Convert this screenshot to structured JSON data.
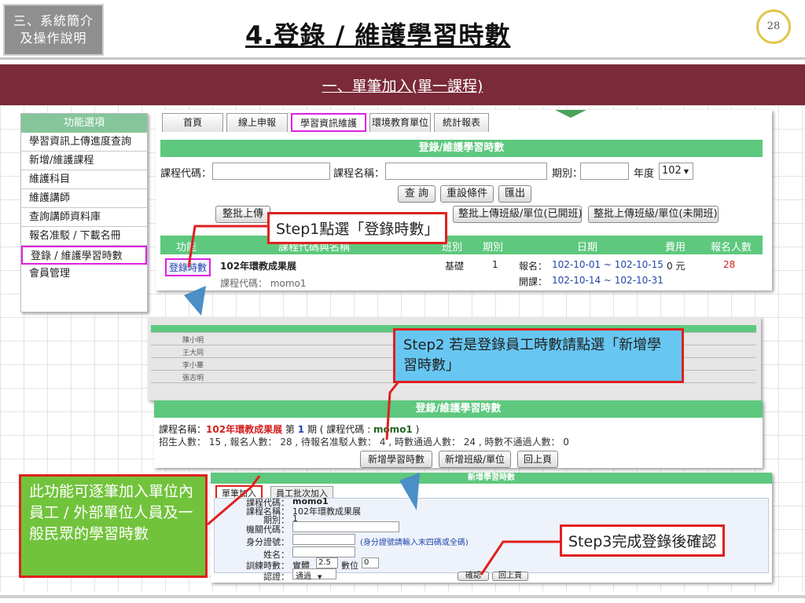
{
  "slide": {
    "chapter_line1": "三、系統簡介",
    "chapter_line2": "及操作說明",
    "title": "4.登錄 / 維護學習時數",
    "page_number": "28",
    "section": "一、單筆加入(單一課程)"
  },
  "sidebar": {
    "header": "功能選項",
    "items": [
      "學習資訊上傳進度查詢",
      "新增/維護課程",
      "維護科目",
      "維護講師",
      "查詢講師資料庫",
      "報名准駁 / 下載名冊",
      "登錄 / 維護學習時數",
      "會員管理"
    ]
  },
  "tabs": [
    "首頁",
    "線上申報",
    "學習資訊維護",
    "環境教育單位",
    "統計報表"
  ],
  "search": {
    "heading": "登錄/維護學習時數",
    "code_label": "課程代碼：",
    "name_label": "課程名稱：",
    "period_label": "期別：",
    "year_label": "年度",
    "year_value": "102",
    "query_button": "查 詢",
    "reset_button": "重設條件",
    "export_button": "匯出",
    "batch_open_button": "整批上傳班級/單位(已開班)",
    "batch_unopen_button": "整批上傳班級/單位(未開班)",
    "batch_left_button": "整批上傳"
  },
  "table": {
    "headers": [
      "功能",
      "課程代碼與名稱",
      "班別",
      "期別",
      "日期",
      "費用",
      "報名人數"
    ],
    "row": {
      "action": "登錄時數",
      "course_name": "102年環教成果展",
      "course_code": "課程代碼： momo1",
      "class": "基礎",
      "period": "1",
      "signup_label": "報名：",
      "signup_dates": "102-10-01 ~ 102-10-15",
      "class_label": "開課：",
      "class_dates": "102-10-14 ~ 102-10-31",
      "fee": "0 元",
      "count": "28"
    }
  },
  "list_preview": {
    "rows": [
      "陳小明",
      "王大同",
      "李小華",
      "張志明"
    ]
  },
  "detail": {
    "heading": "登錄/維護學習時數",
    "course_line_prefix": "課程名稱：",
    "course_name": "102年環教成果展",
    "course_line_mid": "第",
    "course_period": "1",
    "course_line_suffix": "期 ( 課程代碼 :",
    "course_code": "momo1",
    "course_close": ")",
    "stats_line": "招生人數： 15 , 報名人數： 28 , 待報名准駁人數： 4 , 時數通過人數： 24 , 時數不通過人數： 0",
    "add_hours_button": "新增學習時數",
    "add_class_button": "新增班級/單位",
    "back_button": "回上頁"
  },
  "form": {
    "heading": "新增學習時數",
    "tab_single": "單筆加入",
    "tab_batch": "員工批次加入",
    "code_label": "課程代碼：",
    "code_value": "momo1",
    "name_label": "課程名稱：",
    "name_value": "102年環教成果展",
    "period_label": "期別：",
    "period_value": "1",
    "org_label": "機關代碼：",
    "id_label": "身分證號：",
    "id_hint": "(身分證號請輸入末四碼或全碼)",
    "person_label": "姓名：",
    "hours_label": "訓練時數：",
    "hours_type": "實體",
    "hours_value": "2.5",
    "digital_label": "數位",
    "digital_value": "0",
    "cert_label": "認證：",
    "cert_value": "通過",
    "confirm_button": "確認",
    "back_button": "回上頁"
  },
  "callouts": {
    "step1": "Step1點選「登錄時數」",
    "step2": "Step2 若是登錄員工時數請點選「新增學習時數」",
    "step3": "Step3完成登錄後確認",
    "note": "此功能可逐筆加入單位內員工 / 外部單位人員及一般民眾的學習時數"
  },
  "colors": {
    "banner": "#7b2a39",
    "green": "#5ec87e",
    "highlight": "#e020e0",
    "callout_border": "#e02020",
    "callout_blue": "#67c7f2",
    "callout_green": "#72c33c"
  }
}
